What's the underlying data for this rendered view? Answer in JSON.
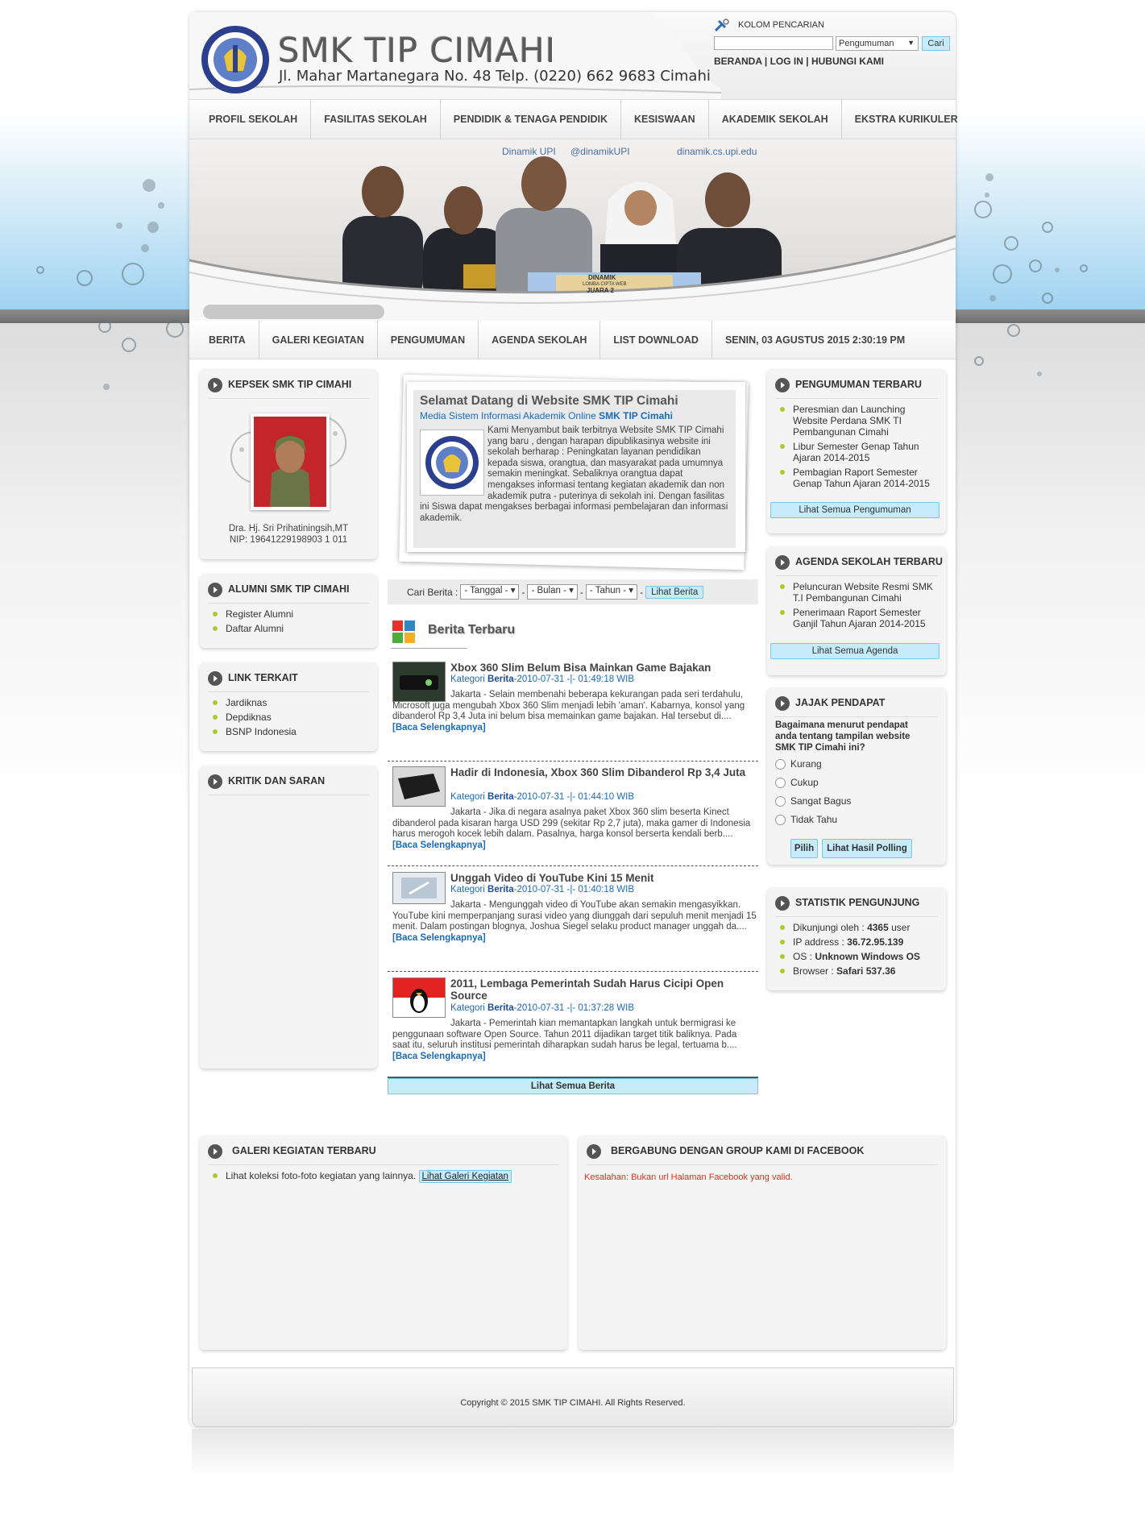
{
  "header": {
    "site_title": "SMK TIP CIMAHI",
    "address": "Jl. Mahar Martanegara No. 48 Telp. (0220) 662 9683 Cimahi",
    "search_title": "KOLOM PENCARIAN",
    "search_value": "",
    "search_select": "Pengumuman",
    "search_button": "Cari",
    "links": [
      "BERANDA",
      "LOG IN",
      "HUBUNGI KAMI"
    ]
  },
  "main_nav": [
    "PROFIL SEKOLAH",
    "FASILITAS SEKOLAH",
    "PENDIDIK & TENAGA PENDIDIK",
    "KESISWAAN",
    "AKADEMIK SEKOLAH",
    "EKSTRA KURIKULER"
  ],
  "banner": {
    "social_text": [
      "Dinamik UPI",
      "@dinamikUPI",
      "dinamik.cs.upi.edu"
    ],
    "board_line1": "DINAMIK",
    "board_line2": "LOMBA CIPTA WEB",
    "board_line3": "JUARA 2"
  },
  "sub_nav": [
    "BERITA",
    "GALERI KEGIATAN",
    "PENGUMUMAN",
    "AGENDA SEKOLAH",
    "LIST DOWNLOAD"
  ],
  "datetime": "SENIN, 03 AGUSTUS 2015 2:30:19 PM",
  "kepsek": {
    "title": "KEPSEK SMK TIP CIMAHI",
    "name": "Dra. Hj. Sri Prihatiningsih,MT",
    "nip": "NIP: 19641229198903 1 011"
  },
  "alumni": {
    "title": "ALUMNI SMK TIP CIMAHI",
    "items": [
      "Register Alumni",
      "Daftar Alumni"
    ]
  },
  "links": {
    "title": "LINK TERKAIT",
    "items": [
      "Jardiknas",
      "Depdiknas",
      "BSNP Indonesia"
    ]
  },
  "kritik": {
    "title": "KRITIK DAN SARAN"
  },
  "welcome": {
    "title": "Selamat Datang di Website SMK TIP Cimahi",
    "subtitle": "Media Sistem Informasi Akademik Online",
    "subtitle_strong": "SMK TIP Cimahi",
    "body": "Kami Menyambut baik terbitnya Website SMK TIP Cimahi yang baru , dengan harapan dipublikasinya website ini sekolah berharap : Peningkatan layanan pendidikan kepada siswa, orangtua, dan masyarakat pada umumnya semakin meningkat. Sebaliknya orangtua dapat mengakses informasi tentang kegiatan akademik dan non akademik putra - puterinya di sekolah ini. Dengan fasilitas ini Siswa dapat mengakses berbagai informasi pembelajaran dan informasi akademik."
  },
  "cari_berita": {
    "label": "Cari Berita :",
    "tanggal": "- Tanggal -",
    "bulan": "- Bulan -",
    "tahun": "- Tahun -",
    "sep": "-",
    "button": "Lihat Berita"
  },
  "berita_title": "Berita Terbaru",
  "news": [
    {
      "title": "Xbox 360 Slim Belum Bisa Mainkan Game Bajakan",
      "cat_label": "Kategori",
      "cat": "Berita",
      "date": "-2010-07-31 -|- 01:49:18 WIB",
      "body": "Jakarta - Selain membenahi beberapa kekurangan pada seri terdahulu, Microsoft juga mengubah Xbox 360 Slim menjadi lebih 'aman'. Kabarnya, konsol yang dibanderol Rp 3,4 Juta ini belum bisa memainkan game bajakan. Hal tersebut di....",
      "more": "[Baca Selengkapnya]"
    },
    {
      "title": "Hadir di Indonesia, Xbox 360 Slim Dibanderol Rp 3,4 Juta",
      "cat_label": "Kategori",
      "cat": "Berita",
      "date": "-2010-07-31 -|- 01:44:10 WIB",
      "body": "Jakarta - Jika di negara asalnya paket Xbox 360 slim beserta Kinect dibanderol pada kisaran harga USD 299 (sekitar Rp 2,7 juta), maka gamer di Indonesia harus merogoh kocek lebih dalam. Pasalnya, harga konsol berserta kendali berb....",
      "more": "[Baca Selengkapnya]"
    },
    {
      "title": "Unggah Video di YouTube Kini 15 Menit",
      "cat_label": "Kategori",
      "cat": "Berita",
      "date": "-2010-07-31 -|- 01:40:18 WIB",
      "body": "Jakarta - Mengunggah video di YouTube akan semakin mengasyikkan. YouTube kini memperpanjang surasi video yang diunggah dari sepuluh menit menjadi 15 menit. Dalam postingan blognya, Joshua Siegel selaku product manager unggah da....",
      "more": "[Baca Selengkapnya]"
    },
    {
      "title": "2011, Lembaga Pemerintah Sudah Harus Cicipi Open Source",
      "cat_label": "Kategori",
      "cat": "Berita",
      "date": "-2010-07-31 -|- 01:37:28 WIB",
      "body": "Jakarta - Pemerintah kian memantapkan langkah untuk bermigrasi ke penggunaan software Open Source. Tahun 2011 dijadikan target titik baliknya. Pada saat itu, seluruh institusi pemerintah diharapkan sudah harus be legal, tertuama b....",
      "more": "[Baca Selengkapnya]"
    }
  ],
  "lihat_semua_berita": "Lihat Semua Berita",
  "pengumuman": {
    "title": "PENGUMUMAN TERBARU",
    "items": [
      "Peresmian dan Launching Website Perdana SMK TI Pembangunan Cimahi",
      "Libur Semester Genap Tahun Ajaran 2014-2015",
      "Pembagian Raport Semester Genap Tahun Ajaran 2014-2015"
    ],
    "button": "Lihat Semua Pengumuman"
  },
  "agenda": {
    "title": "AGENDA SEKOLAH TERBARU",
    "items": [
      "Peluncuran Website Resmi SMK T.I Pembangunan Cimahi",
      "Penerimaan Raport Semester Ganjil Tahun Ajaran 2014-2015"
    ],
    "button": "Lihat Semua Agenda"
  },
  "jajak": {
    "title": "JAJAK PENDAPAT",
    "question": "Bagaimana menurut pendapat anda tentang tampilan website SMK TIP Cimahi ini?",
    "options": [
      "Kurang",
      "Cukup",
      "Sangat Bagus",
      "Tidak Tahu"
    ],
    "btn_pilih": "Pilih",
    "btn_hasil": "Lihat Hasil Polling"
  },
  "statistik": {
    "title": "STATISTIK PENGUNJUNG",
    "rows": [
      {
        "label": "Dikunjungi oleh :",
        "value": "4365",
        "suffix": "user"
      },
      {
        "label": "IP address :",
        "value": "36.72.95.139",
        "suffix": ""
      },
      {
        "label": "OS :",
        "value": "Unknown Windows OS",
        "suffix": ""
      },
      {
        "label": "Browser :",
        "value": "Safari 537.36",
        "suffix": ""
      }
    ]
  },
  "galeri": {
    "title": "GALERI KEGIATAN TERBARU",
    "text": "Lihat koleksi foto-foto kegiatan yang lainnya.",
    "link": "Lihat Galeri Kegiatan"
  },
  "facebook": {
    "title": "BERGABUNG DENGAN GROUP KAMI DI FACEBOOK",
    "error": "Kesalahan: Bukan url Halaman Facebook yang valid."
  },
  "footer": {
    "copyright": "Copyright © 2015 SMK TIP CIMAHI. All Rights Reserved."
  },
  "colors": {
    "accent_button": "#c6ecfb",
    "link_blue": "#1a6bb8",
    "bullet_green": "#a9cb2e",
    "error_red": "#e0301e"
  }
}
